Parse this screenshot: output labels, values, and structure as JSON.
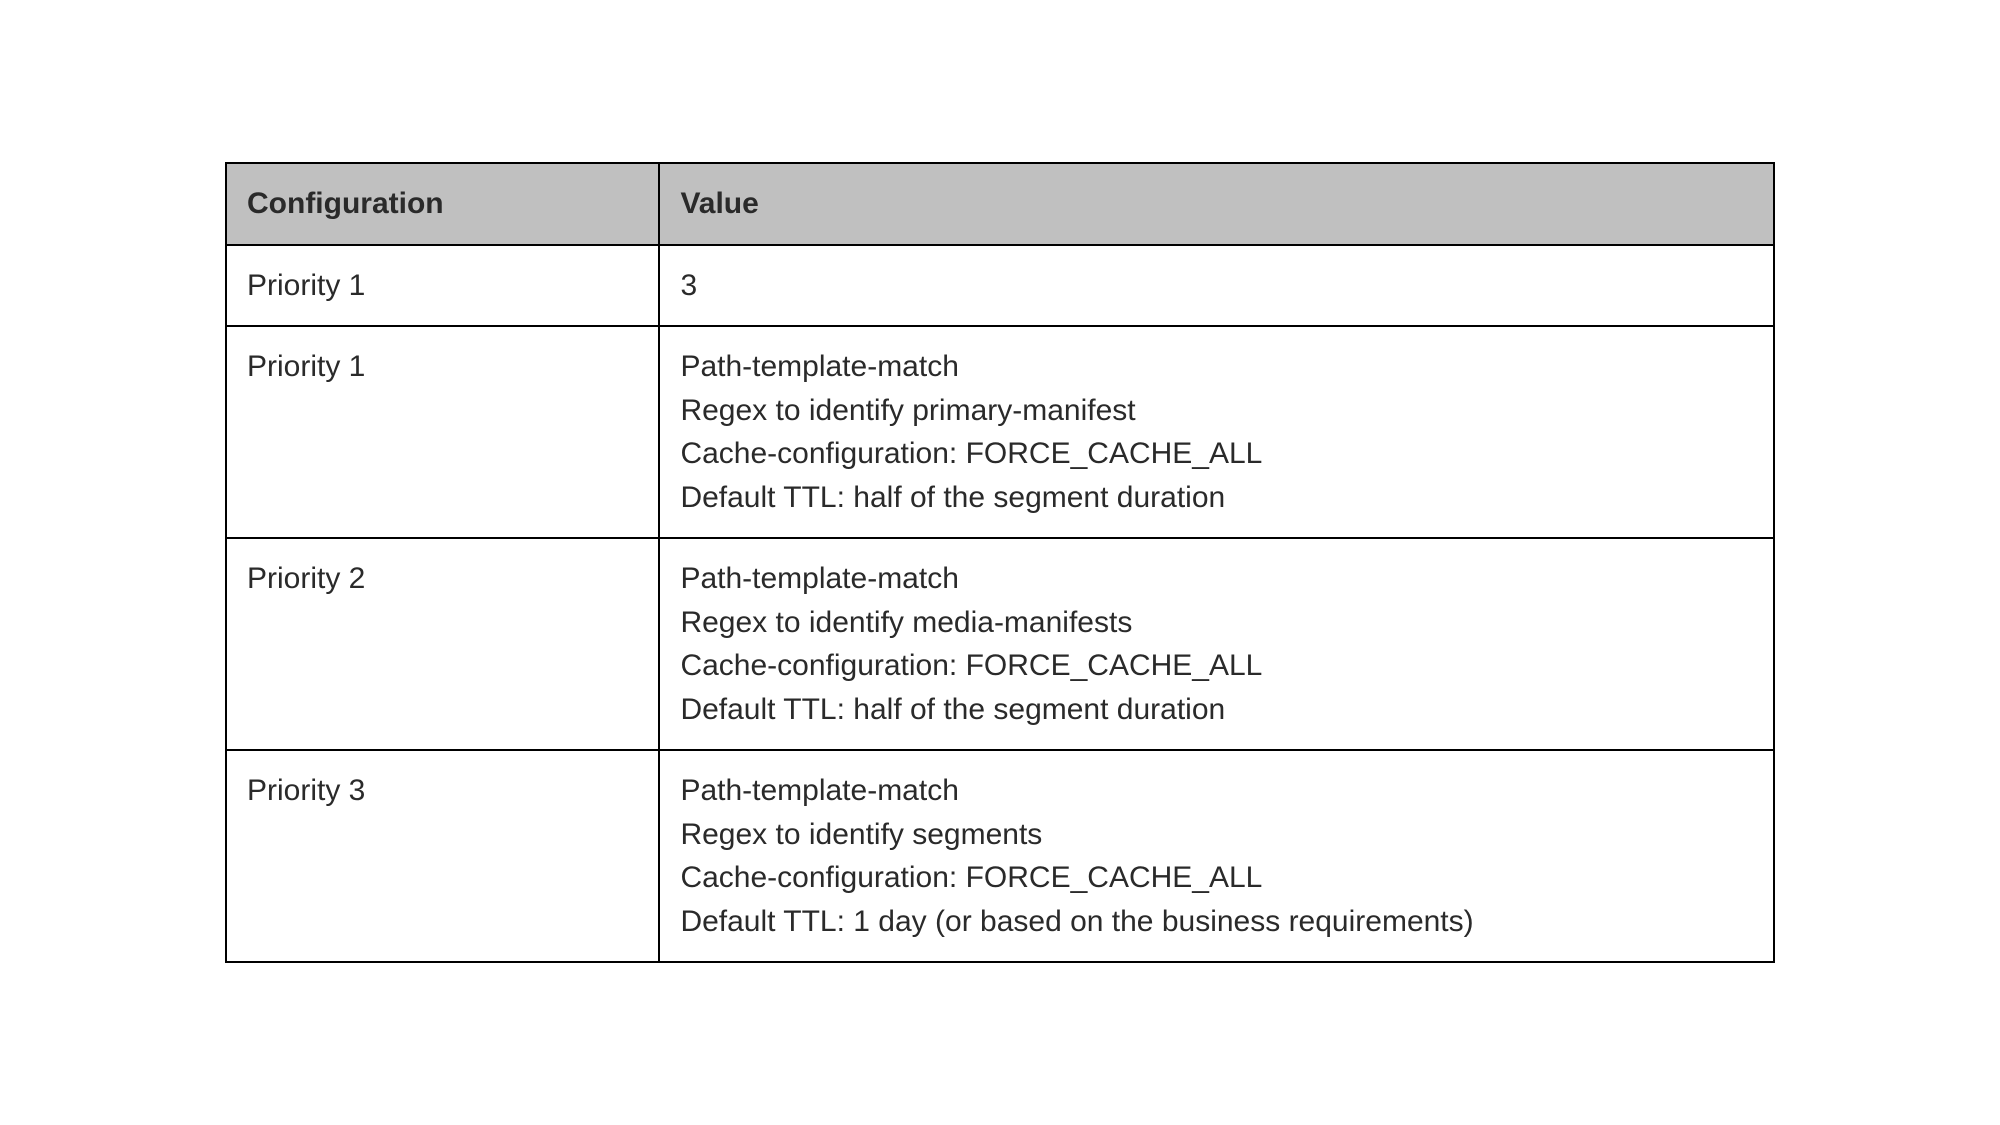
{
  "table": {
    "headers": {
      "config": "Configuration",
      "value": "Value"
    },
    "rows": [
      {
        "config": "Priority 1",
        "value_lines": [
          "3"
        ]
      },
      {
        "config": "Priority 1",
        "value_lines": [
          "Path-template-match",
          "Regex to identify primary-manifest",
          "Cache-configuration: FORCE_CACHE_ALL",
          "Default TTL: half of the segment duration"
        ]
      },
      {
        "config": "Priority 2",
        "value_lines": [
          "Path-template-match",
          "Regex to identify media-manifests",
          "Cache-configuration: FORCE_CACHE_ALL",
          "Default TTL: half of the segment duration"
        ]
      },
      {
        "config": "Priority 3",
        "value_lines": [
          "Path-template-match",
          "Regex to identify segments",
          "Cache-configuration: FORCE_CACHE_ALL",
          "Default TTL: 1 day (or based on the business requirements)"
        ]
      }
    ]
  }
}
